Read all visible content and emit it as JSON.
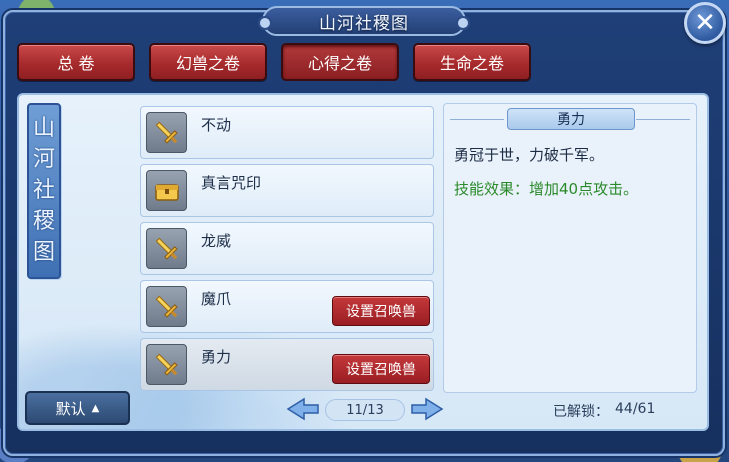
{
  "window": {
    "title": "山河社稷图",
    "close_glyph": "✕"
  },
  "tabs": [
    {
      "label": "总 卷",
      "active": false
    },
    {
      "label": "幻兽之卷",
      "active": false
    },
    {
      "label": "心得之卷",
      "active": true
    },
    {
      "label": "生命之卷",
      "active": false
    }
  ],
  "seal": {
    "chars": [
      "山",
      "河",
      "社",
      "稷",
      "图"
    ]
  },
  "skills": [
    {
      "name": "不动",
      "icon": "sword-icon",
      "button": ""
    },
    {
      "name": "真言咒印",
      "icon": "chest-icon",
      "button": ""
    },
    {
      "name": "龙威",
      "icon": "sword-icon",
      "button": ""
    },
    {
      "name": "魔爪",
      "icon": "sword-icon",
      "button": "设置召唤兽"
    },
    {
      "name": "勇力",
      "icon": "sword-icon",
      "button": "设置召唤兽",
      "selected": true
    }
  ],
  "detail": {
    "title": "勇力",
    "description": "勇冠于世，力破千军。",
    "effect": "技能效果：增加40点攻击。"
  },
  "footer": {
    "sort_label": "默认",
    "page_indicator": "11/13",
    "unlock_label": "已解锁：",
    "unlock_count": "44/61"
  },
  "colors": {
    "tab_red": "#a72a2c",
    "effect_green": "#2a8a2a",
    "panel_blue": "#1f3f78"
  }
}
